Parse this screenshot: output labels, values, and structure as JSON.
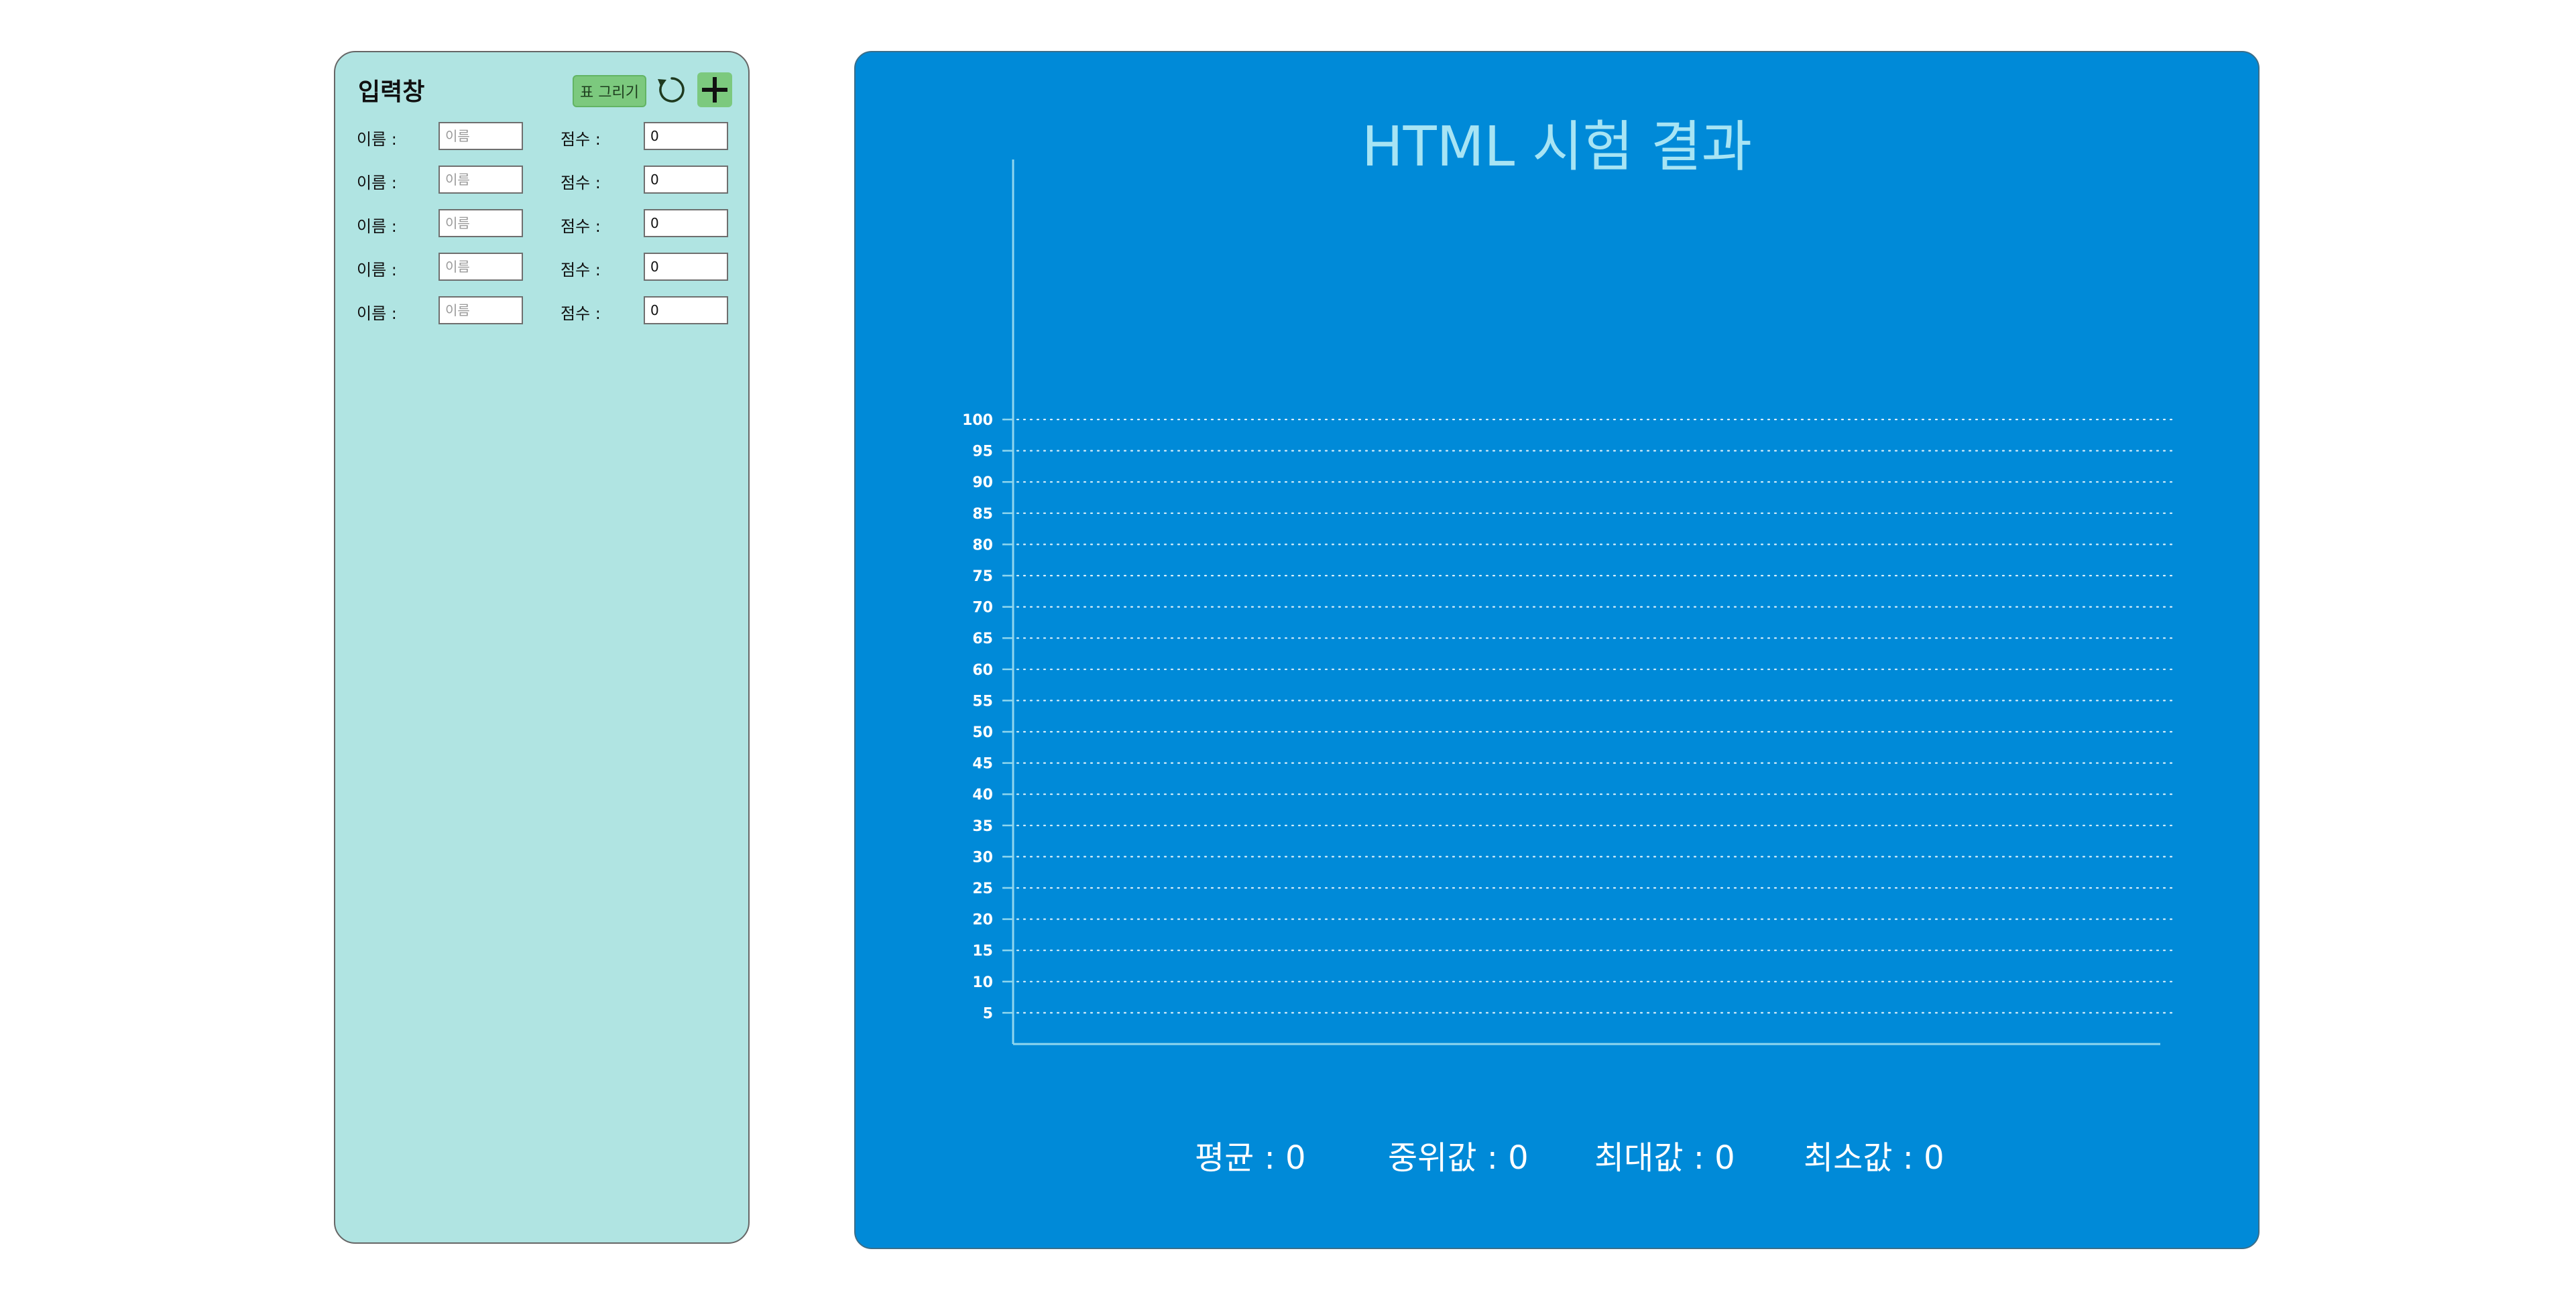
{
  "input_panel": {
    "title": "입력창",
    "draw_label": "표 그리기",
    "rows": [
      {
        "name_label": "이름 :",
        "name_placeholder": "이름",
        "name_value": "",
        "score_label": "점수 :",
        "score_value": "0"
      },
      {
        "name_label": "이름 :",
        "name_placeholder": "이름",
        "name_value": "",
        "score_label": "점수 :",
        "score_value": "0"
      },
      {
        "name_label": "이름 :",
        "name_placeholder": "이름",
        "name_value": "",
        "score_label": "점수 :",
        "score_value": "0"
      },
      {
        "name_label": "이름 :",
        "name_placeholder": "이름",
        "name_value": "",
        "score_label": "점수 :",
        "score_value": "0"
      },
      {
        "name_label": "이름 :",
        "name_placeholder": "이름",
        "name_value": "",
        "score_label": "점수 :",
        "score_value": "0"
      }
    ],
    "icons": [
      "refresh-icon",
      "plus-icon"
    ]
  },
  "chart_panel": {
    "title": "HTML 시험 결과",
    "stats": {
      "avg": "평균 : 0",
      "median": "중위값 : 0",
      "max": "최대값 : 0",
      "min": "최소값 : 0"
    }
  },
  "colors": {
    "input_panel_bg": "#b0e4e2",
    "button_green": "#7cc97e",
    "chart_bg": "#008ad8",
    "chart_title": "#a7e4f4",
    "axis": "#8fd6ee"
  },
  "chart_data": {
    "type": "bar",
    "title": "HTML 시험 결과",
    "categories": [],
    "values": [],
    "ylim": [
      0,
      100
    ],
    "y_ticks": [
      5,
      10,
      15,
      20,
      25,
      30,
      35,
      40,
      45,
      50,
      55,
      60,
      65,
      70,
      75,
      80,
      85,
      90,
      95,
      100
    ],
    "grid": true,
    "grid_style": "dotted"
  }
}
